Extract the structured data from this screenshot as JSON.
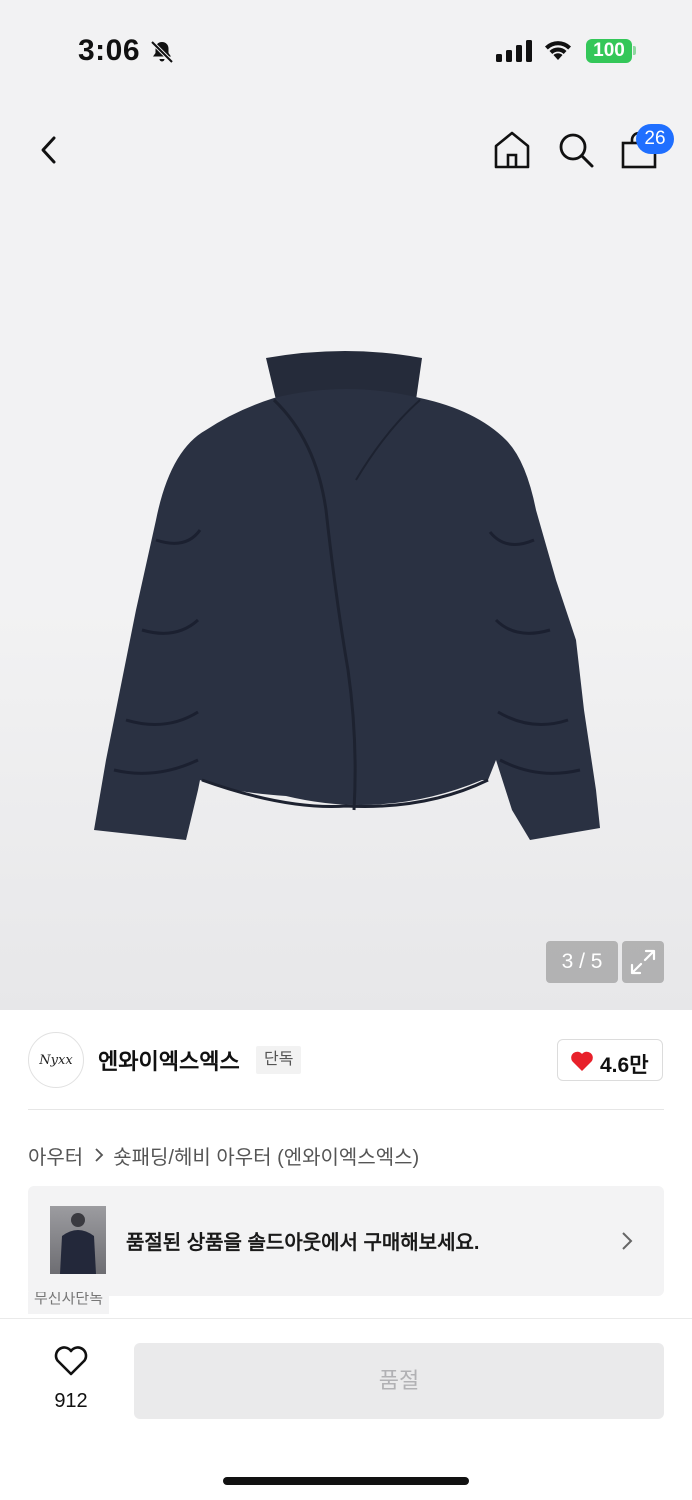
{
  "status": {
    "time": "3:06",
    "battery": "100"
  },
  "nav": {
    "cart_count": "26"
  },
  "gallery": {
    "counter": "3 / 5"
  },
  "brand": {
    "logo_text": "Nyxx",
    "name": "엔와이엑스엑스",
    "exclusive_badge": "단독",
    "likes": "4.6만"
  },
  "breadcrumb": {
    "category": "아우터",
    "subcategory": "숏패딩/헤비 아우터 (엔와이엑스엑스)"
  },
  "soldout_banner": {
    "text": "품절된 상품을 솔드아웃에서 구매해보세요.",
    "promo_tag": "무신사단독"
  },
  "bottom": {
    "wish_count": "912",
    "buy_label": "품절"
  },
  "colors": {
    "accent_blue": "#1f6fff",
    "heart_red": "#e8202a",
    "battery_green": "#34c759",
    "jacket_navy": "#2a3142"
  },
  "icons": [
    "back-icon",
    "home-icon",
    "search-icon",
    "bag-icon",
    "expand-icon",
    "heart-icon",
    "chevron-right-icon"
  ]
}
